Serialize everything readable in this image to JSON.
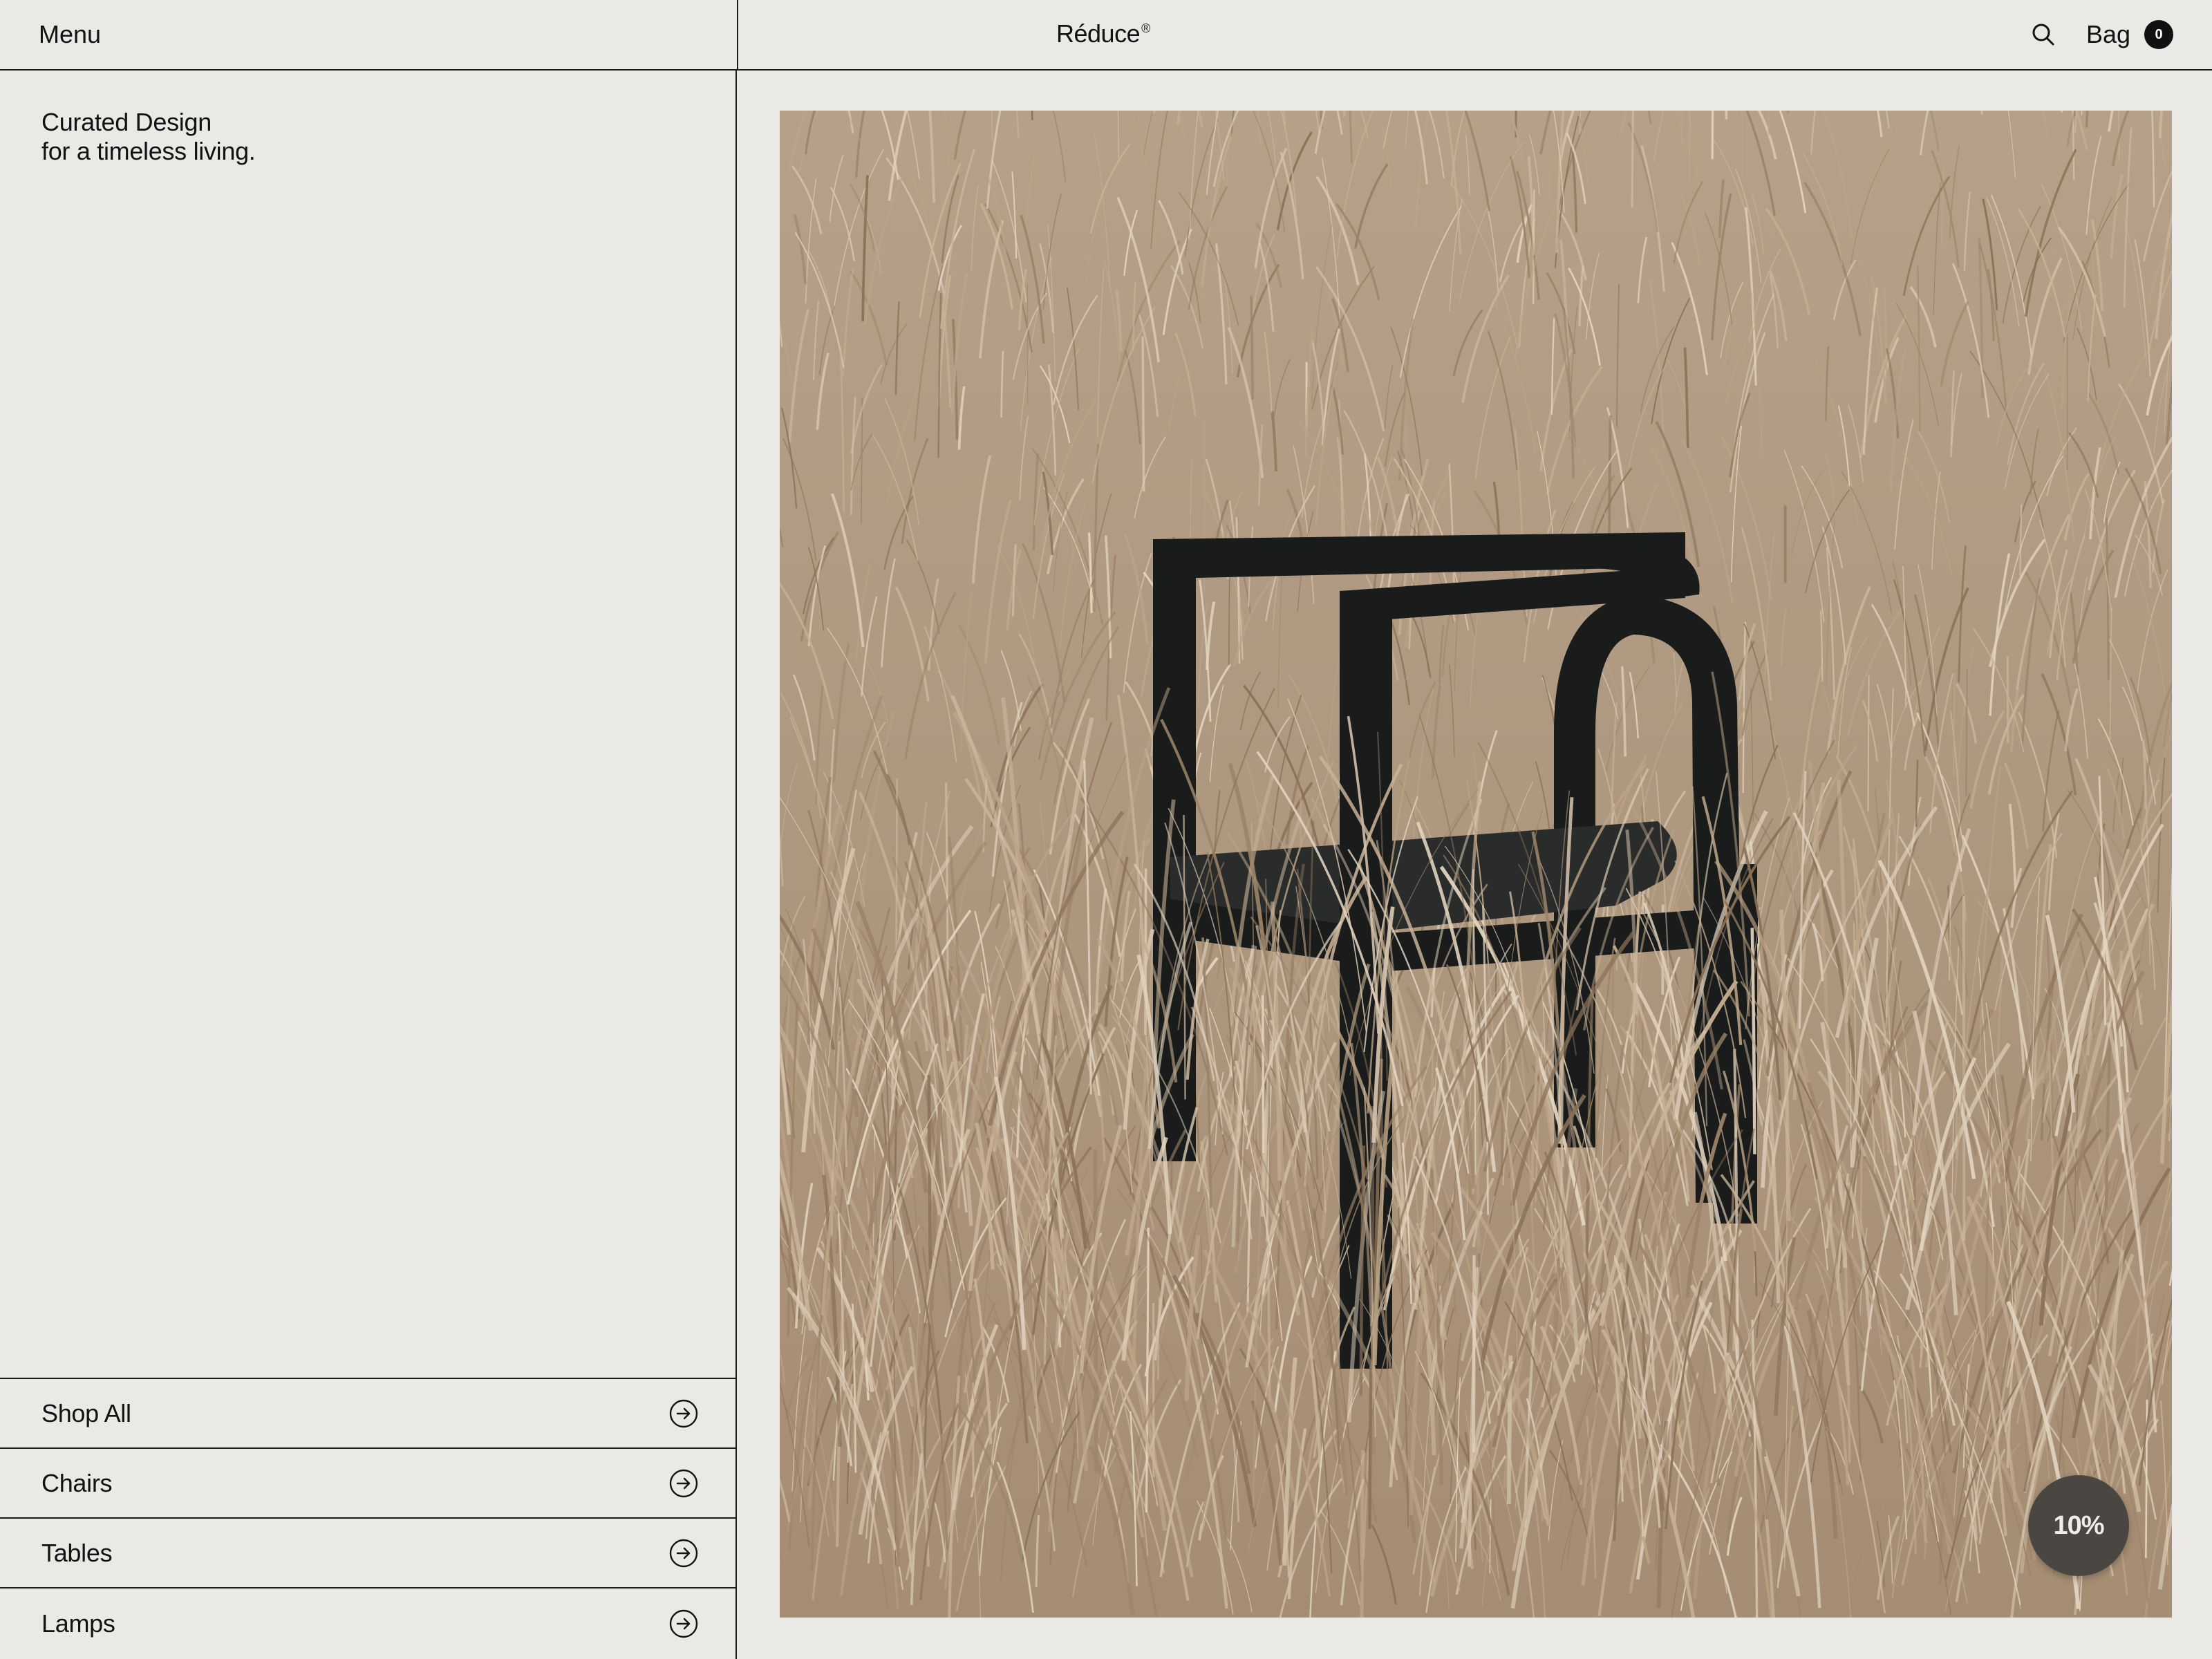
{
  "header": {
    "menu_label": "Menu",
    "brand_name": "Réduce",
    "brand_mark": "®",
    "search_icon": "search-icon",
    "bag_label": "Bag",
    "bag_count": "0"
  },
  "sidebar": {
    "tagline_line1": "Curated Design",
    "tagline_line2": "for a timeless living.",
    "categories": [
      {
        "label": "Shop All",
        "icon": "arrow-right-circle-icon"
      },
      {
        "label": "Chairs",
        "icon": "arrow-right-circle-icon"
      },
      {
        "label": "Tables",
        "icon": "arrow-right-circle-icon"
      },
      {
        "label": "Lamps",
        "icon": "arrow-right-circle-icon"
      }
    ]
  },
  "hero": {
    "subject": "black wooden armchair standing in dry tall grass",
    "discount_label": "10%"
  },
  "colors": {
    "background": "#ebe9e5",
    "ink": "#121212",
    "grass": "#b29d86",
    "chair": "#1a1c1c",
    "badge": "#4a4642"
  }
}
